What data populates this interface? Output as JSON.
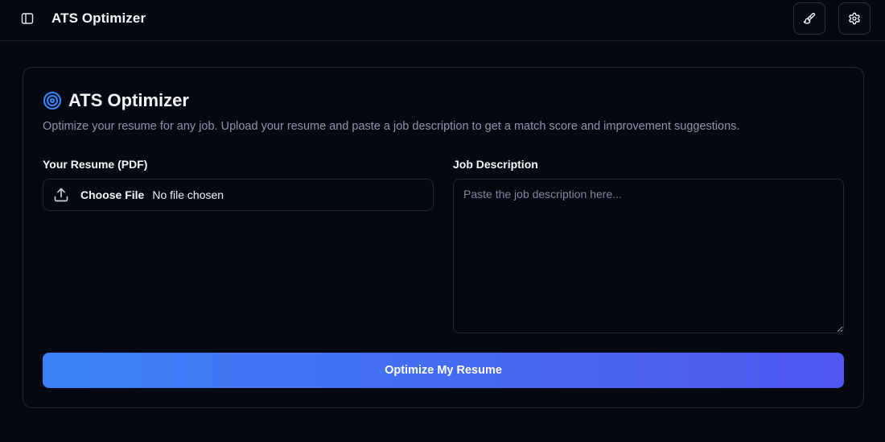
{
  "header": {
    "title": "ATS Optimizer",
    "sidebar_toggle_icon": "sidebar-panel-icon",
    "theme_icon": "paintbrush-icon",
    "settings_icon": "gear-icon"
  },
  "card": {
    "icon": "target-icon",
    "title": "ATS Optimizer",
    "description": "Optimize your resume for any job. Upload your resume and paste a job description to get a match score and improvement suggestions."
  },
  "resume": {
    "label": "Your Resume (PDF)",
    "icon": "upload-icon",
    "choose_label": "Choose File",
    "status": "No file chosen"
  },
  "job": {
    "label": "Job Description",
    "value": "",
    "placeholder": "Paste the job description here..."
  },
  "submit": {
    "label": "Optimize My Resume"
  },
  "colors": {
    "background": "#050811",
    "accent_start": "#3b82f6",
    "accent_end": "#4f56ee",
    "target_icon": "#3b82f6"
  }
}
